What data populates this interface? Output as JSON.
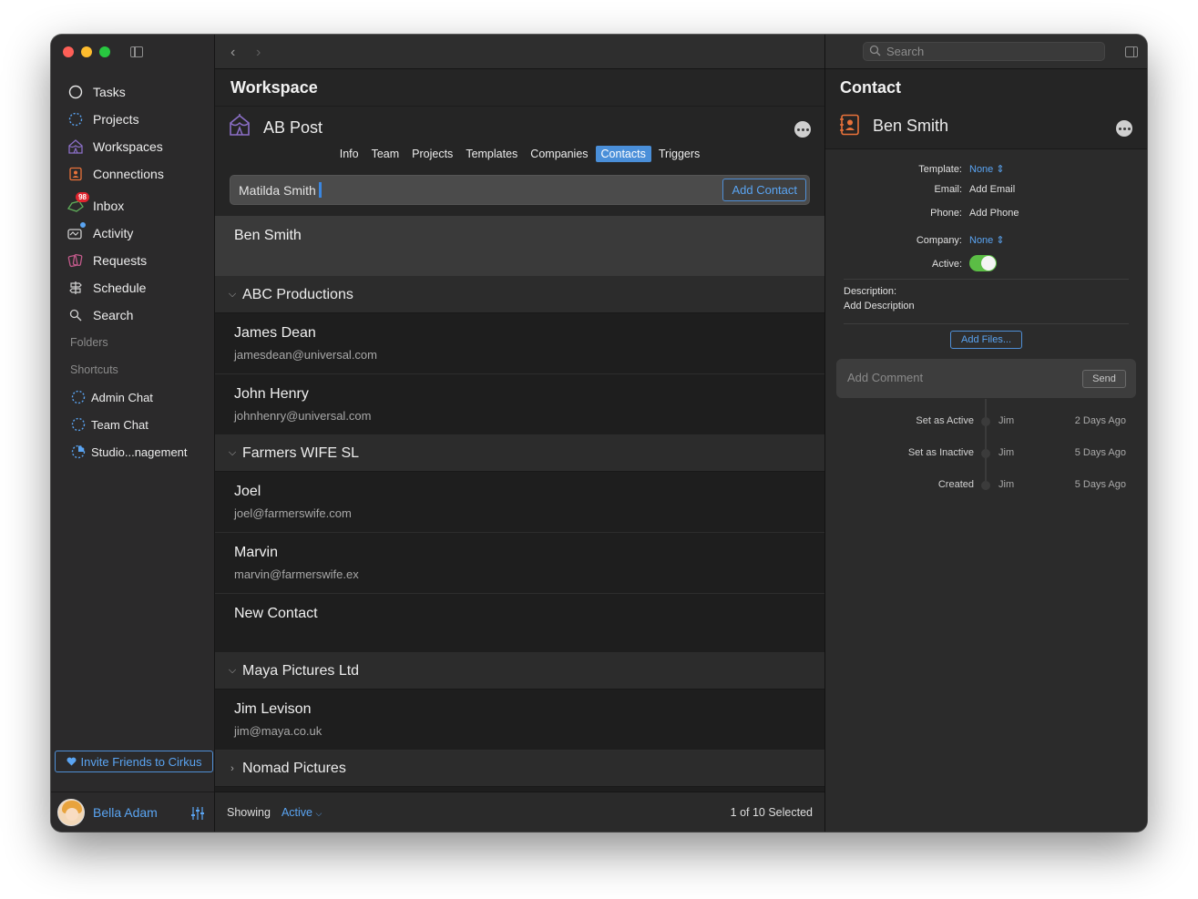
{
  "sidebar": {
    "nav": [
      {
        "label": "Tasks",
        "icon": "circle-icon"
      },
      {
        "label": "Projects",
        "icon": "dotted-circle-icon"
      },
      {
        "label": "Workspaces",
        "icon": "circus-tent-icon"
      },
      {
        "label": "Connections",
        "icon": "contact-book-icon"
      }
    ],
    "nav2": [
      {
        "label": "Inbox",
        "icon": "inbox-tray-icon",
        "badge": "98"
      },
      {
        "label": "Activity",
        "icon": "activity-icon"
      },
      {
        "label": "Requests",
        "icon": "requests-icon"
      },
      {
        "label": "Schedule",
        "icon": "signpost-icon"
      },
      {
        "label": "Search",
        "icon": "magnifier-icon"
      }
    ],
    "folders_label": "Folders",
    "shortcuts_label": "Shortcuts",
    "shortcuts": [
      {
        "label": "Admin Chat"
      },
      {
        "label": "Team Chat"
      },
      {
        "label": "Studio...nagement"
      }
    ],
    "invite_label": "Invite Friends to Cirkus",
    "user_name": "Bella Adam"
  },
  "workspace": {
    "pane_title": "Workspace",
    "name": "AB Post",
    "tabs": [
      "Info",
      "Team",
      "Projects",
      "Templates",
      "Companies",
      "Contacts",
      "Triggers"
    ],
    "active_tab": "Contacts",
    "input_value": "Matilda Smith",
    "add_contact_label": "Add Contact"
  },
  "list": {
    "selected": {
      "name": "Ben Smith"
    },
    "groups": [
      {
        "name": "ABC Productions",
        "expanded": true,
        "contacts": [
          {
            "name": "James Dean",
            "email": "jamesdean@universal.com"
          },
          {
            "name": "John Henry",
            "email": "johnhenry@universal.com"
          }
        ]
      },
      {
        "name": "Farmers WIFE SL",
        "expanded": true,
        "contacts": [
          {
            "name": "Joel",
            "email": "joel@farmerswife.com"
          },
          {
            "name": "Marvin",
            "email": "marvin@farmerswife.ex"
          },
          {
            "name": "New Contact",
            "email": ""
          }
        ]
      },
      {
        "name": "Maya Pictures Ltd",
        "expanded": true,
        "contacts": [
          {
            "name": "Jim Levison",
            "email": "jim@maya.co.uk"
          }
        ]
      },
      {
        "name": "Nomad Pictures",
        "expanded": false,
        "contacts": []
      }
    ]
  },
  "footer": {
    "showing_label": "Showing",
    "showing_value": "Active",
    "selection": "1 of 10 Selected"
  },
  "inspector": {
    "search_placeholder": "Search",
    "title": "Contact",
    "contact_name": "Ben Smith",
    "template_label": "Template:",
    "template_value": "None",
    "email_label": "Email:",
    "email_value": "Add Email",
    "phone_label": "Phone:",
    "phone_value": "Add Phone",
    "company_label": "Company:",
    "company_value": "None",
    "active_label": "Active:",
    "active_value": true,
    "description_label": "Description:",
    "description_value": "Add Description",
    "add_files_label": "Add Files...",
    "comment_placeholder": "Add Comment",
    "send_label": "Send",
    "timeline": [
      {
        "action": "Set as Active",
        "user": "Jim",
        "time": "2 Days Ago"
      },
      {
        "action": "Set as Inactive",
        "user": "Jim",
        "time": "5 Days Ago"
      },
      {
        "action": "Created",
        "user": "Jim",
        "time": "5 Days Ago"
      }
    ]
  },
  "colors": {
    "accent": "#4a8fd9",
    "toggle_on": "#5bbd45",
    "badge": "#e0242e"
  }
}
